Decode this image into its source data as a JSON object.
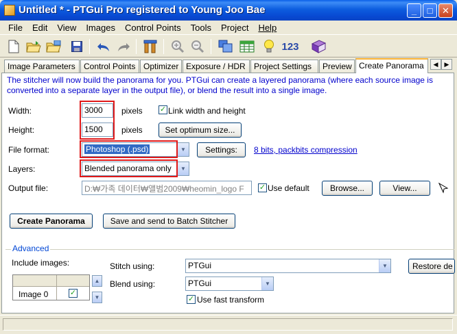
{
  "window": {
    "title": "Untitled * - PTGui Pro registered to Young Joo Bae",
    "minimize_label": "_",
    "maximize_label": "□",
    "close_label": "✕"
  },
  "menu": [
    "File",
    "Edit",
    "View",
    "Images",
    "Control Points",
    "Tools",
    "Project",
    "Help"
  ],
  "toolbar": {
    "icons": [
      "new-file-icon",
      "open-folder-icon",
      "open-recent-icon",
      "save-icon",
      "undo-icon",
      "redo-icon",
      "tools-icon",
      "zoom-in-icon",
      "zoom-out-icon",
      "panorama-editor-icon",
      "table-icon",
      "lightbulb-icon",
      "numbers-icon",
      "book-icon"
    ],
    "numbers_label": "123"
  },
  "tabs": [
    {
      "label": "Image Parameters"
    },
    {
      "label": "Control Points"
    },
    {
      "label": "Optimizer"
    },
    {
      "label": "Exposure / HDR"
    },
    {
      "label": "Project Settings"
    },
    {
      "label": "Preview"
    },
    {
      "label": "Create Panorama",
      "active": true
    }
  ],
  "intro": "The stitcher will now build the panorama for you. PTGui can create a layered panorama (where each source image is converted into a separate layer in the output file), or blend the result into a single image.",
  "form": {
    "width_label": "Width:",
    "width_value": "3000",
    "height_label": "Height:",
    "height_value": "1500",
    "pixels_label": "pixels",
    "link_label": "Link width and height",
    "link_checked": true,
    "optimum_button": "Set optimum size...",
    "format_label": "File format:",
    "format_value": "Photoshop (.psd)",
    "settings_button": "Settings:",
    "settings_link": "8 bits, packbits compression",
    "layers_label": "Layers:",
    "layers_value": "Blended panorama only",
    "output_label": "Output file:",
    "output_value": "D:₩가족 데이터₩앨범2009₩heomin_logo F",
    "use_default_label": "Use default",
    "use_default_checked": true,
    "browse_button": "Browse...",
    "view_button": "View..."
  },
  "actions": {
    "create_button": "Create Panorama",
    "batch_button": "Save and send to Batch Stitcher"
  },
  "advanced": {
    "title": "Advanced",
    "include_label": "Include images:",
    "image_row": "Image 0",
    "image_checked": true,
    "stitch_label": "Stitch using:",
    "stitch_value": "PTGui",
    "blend_label": "Blend using:",
    "blend_value": "PTGui",
    "fast_transform_label": "Use fast transform",
    "fast_transform_checked": true,
    "restore_button": "Restore de"
  },
  "check_glyph": "✓",
  "arrow_down": "▼",
  "arrow_up": "▲",
  "arrow_left": "◀",
  "arrow_right": "▶",
  "highlight_color": "#e01818",
  "accent_color": "#0a44c4"
}
